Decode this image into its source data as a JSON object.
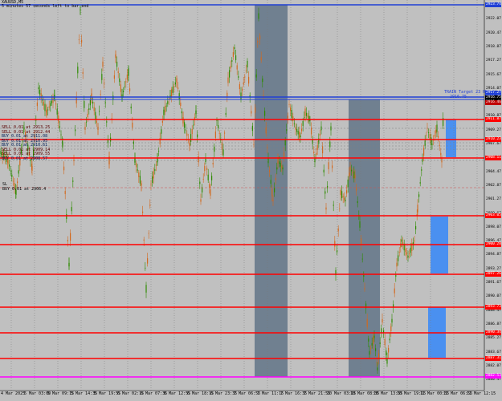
{
  "header": {
    "symbol": "XAUUSD,M5",
    "timer": "5 minutes 57 seconds left to bar end"
  },
  "colors": {
    "background": "#c0c0c0",
    "candle_up": "#2e8b00",
    "candle_down": "#d2691e",
    "level_red": "#ff0000",
    "level_blue": "#1f3fd6",
    "level_magenta": "#ff00ff",
    "zone_slate": "#708090",
    "zone_blue": "#4a90f0"
  },
  "price_axis": [
    "2923.74",
    "2922.07",
    "2920.47",
    "2918.87",
    "2917.27",
    "2915.67",
    "2914.07",
    "2912.47",
    "2910.87",
    "2909.27",
    "2907.67",
    "2906.07",
    "2904.47",
    "2902.87",
    "2901.27",
    "2899.67",
    "2898.07",
    "2896.47",
    "2894.87",
    "2893.27",
    "2891.67",
    "2890.07",
    "2888.47",
    "2886.87",
    "2885.27",
    "2883.67",
    "2882.07",
    "2880.47"
  ],
  "time_axis": [
    "4 Mar 2025",
    "5 Mar 03:00",
    "5 Mar 09:15",
    "5 Mar 14:35",
    "5 Mar 19:55",
    "6 Mar 02:15",
    "6 Mar 07:35",
    "6 Mar 12:55",
    "6 Mar 18:15",
    "6 Mar 23:35",
    "7 Mar 06:55",
    "7 Mar 11:15",
    "7 Mar 16:35",
    "7 Mar 21:55",
    "10 Mar 03:15",
    "10 Mar 08:35",
    "10 Mar 13:55",
    "10 Mar 19:15",
    "11 Mar 00:35",
    "11 Mar 06:55",
    "11 Mar 12:15"
  ],
  "tags": {
    "top_blue": "2923.74",
    "upper_blue": "2917.27",
    "bid": "2916.75",
    "ask": "2916.46",
    "r1": "2911.87",
    "r2": "2910.23",
    "r3": "2908.11",
    "s1": "2903.05",
    "s2": "2900.28",
    "s3": "2897.26",
    "s4": "2893.73",
    "s5": "2890.34",
    "s6": "2887.31",
    "s7": "2884.46",
    "magenta": "2882.53"
  },
  "orders": [
    "SELL 0.01 at 2913.25",
    "SELL 0.01 at 2912.44",
    "BUY 0.01 at 2911.08",
    "BUY 0.01 at 2910.95",
    "BUY 0.01 at 2910.61",
    "SELL 0.01 at 2909.14",
    "SELL 0.01 at 2909.55",
    "BUY 0.01 at 2908.57"
  ],
  "order_labels": {
    "sl": "SL",
    "buy_order": "BUY 0.01 at 2906.4"
  },
  "price_label": "TRAIN Target 23 HRS 1",
  "price_sub": "2916.75"
}
